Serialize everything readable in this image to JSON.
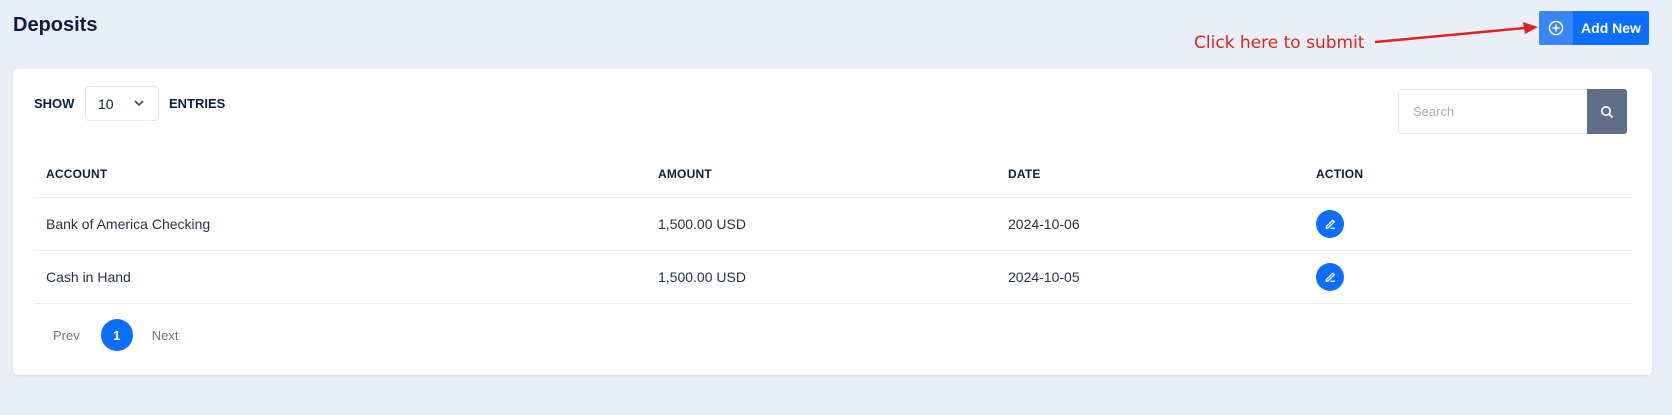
{
  "page": {
    "title": "Deposits"
  },
  "header": {
    "add_new_label": "Add New",
    "add_icon": "plus-circle-icon",
    "annotation_text": "Click here to submit",
    "annotation_color": "#e0231c"
  },
  "controls": {
    "show_label": "SHOW",
    "entries_label": "ENTRIES",
    "page_size": "10",
    "search_placeholder": "Search",
    "search_icon": "search-icon"
  },
  "table": {
    "columns": [
      "ACCOUNT",
      "AMOUNT",
      "DATE",
      "ACTION"
    ],
    "rows": [
      {
        "account": "Bank of America Checking",
        "amount": "1,500.00 USD",
        "date": "2024-10-06",
        "action_icon": "edit-icon"
      },
      {
        "account": "Cash in Hand",
        "amount": "1,500.00 USD",
        "date": "2024-10-05",
        "action_icon": "edit-icon"
      }
    ]
  },
  "pagination": {
    "prev_label": "Prev",
    "current_page": "1",
    "next_label": "Next"
  },
  "colors": {
    "primary": "#0d6efd",
    "background": "#e9eef8",
    "search_button": "#5f6e89"
  }
}
